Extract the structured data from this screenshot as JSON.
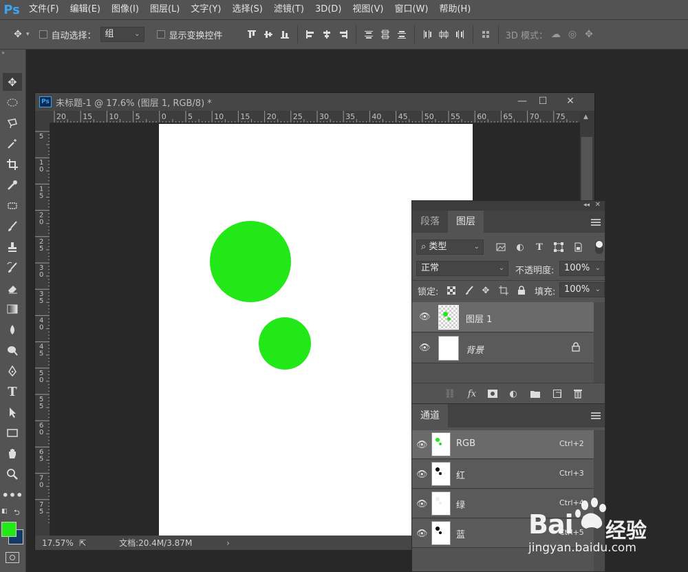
{
  "app": {
    "logo": "Ps",
    "menu": [
      "文件(F)",
      "编辑(E)",
      "图像(I)",
      "图层(L)",
      "文字(Y)",
      "选择(S)",
      "滤镜(T)",
      "3D(D)",
      "视图(V)",
      "窗口(W)",
      "帮助(H)"
    ]
  },
  "options": {
    "auto_select_label": "自动选择：",
    "auto_select_value": "组",
    "show_transform_label": "显示变换控件",
    "mode_3d_label": "3D 模式："
  },
  "document": {
    "title": "未标题-1 @ 17.6% (图层 1, RGB/8) *",
    "ps_icon": "Ps",
    "ruler_top": [
      "20",
      "15",
      "10",
      "5",
      "0",
      "5",
      "10",
      "15",
      "20",
      "25",
      "30",
      "35",
      "40",
      "45",
      "50",
      "55",
      "60",
      "65",
      "70",
      "75"
    ],
    "ruler_left": [
      "5",
      "10",
      "15",
      "20",
      "25",
      "30",
      "35",
      "40",
      "45",
      "50",
      "55",
      "60",
      "65",
      "70",
      "75"
    ],
    "zoom": "17.57%",
    "doc_info": "文档:20.4M/3.87M",
    "shape_color": "#22e818"
  },
  "layers_panel": {
    "tabs": [
      "段落",
      "图层"
    ],
    "filter_label": "类型",
    "blend_mode": "正常",
    "opacity_label": "不透明度:",
    "opacity_value": "100%",
    "lock_label": "锁定:",
    "fill_label": "填充:",
    "fill_value": "100%",
    "layers": [
      {
        "name": "图层 1"
      },
      {
        "name": "背景"
      }
    ]
  },
  "channels_panel": {
    "tab": "通道",
    "channels": [
      {
        "name": "RGB",
        "shortcut": "Ctrl+2"
      },
      {
        "name": "红",
        "shortcut": "Ctrl+3"
      },
      {
        "name": "绿",
        "shortcut": "Ctrl+4"
      },
      {
        "name": "蓝",
        "shortcut": "Ctrl+5"
      }
    ]
  },
  "colors": {
    "foreground": "#22e818",
    "background": "#163a66"
  },
  "watermark": {
    "brand": "Bai",
    "brand_cn": "经验",
    "url": "jingyan.baidu.com"
  }
}
